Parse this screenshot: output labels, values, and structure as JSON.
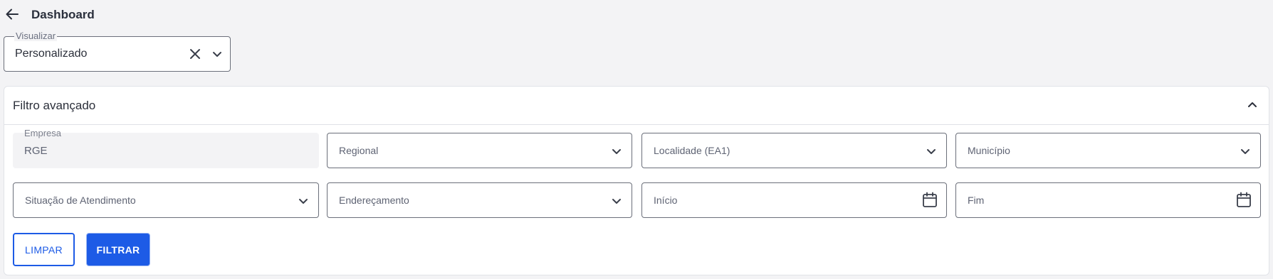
{
  "header": {
    "title": "Dashboard",
    "back_icon": "arrow-left-icon"
  },
  "view_select": {
    "legend": "Visualizar",
    "value": "Personalizado"
  },
  "filter_panel": {
    "title": "Filtro avançado",
    "expanded": true,
    "fields": {
      "empresa": {
        "legend": "Empresa",
        "value": "RGE",
        "disabled": true
      },
      "regional": {
        "placeholder": "Regional"
      },
      "localidade": {
        "placeholder": "Localidade (EA1)"
      },
      "municipio": {
        "placeholder": "Município"
      },
      "situacao": {
        "placeholder": "Situação de Atendimento"
      },
      "enderecamento": {
        "placeholder": "Endereçamento"
      },
      "inicio": {
        "placeholder": "Início"
      },
      "fim": {
        "placeholder": "Fim"
      }
    },
    "buttons": {
      "clear": "LIMPAR",
      "filter": "FILTRAR"
    }
  },
  "colors": {
    "primary": "#1d5be6",
    "background": "#f3f3f5",
    "border": "#6b6f7a"
  }
}
